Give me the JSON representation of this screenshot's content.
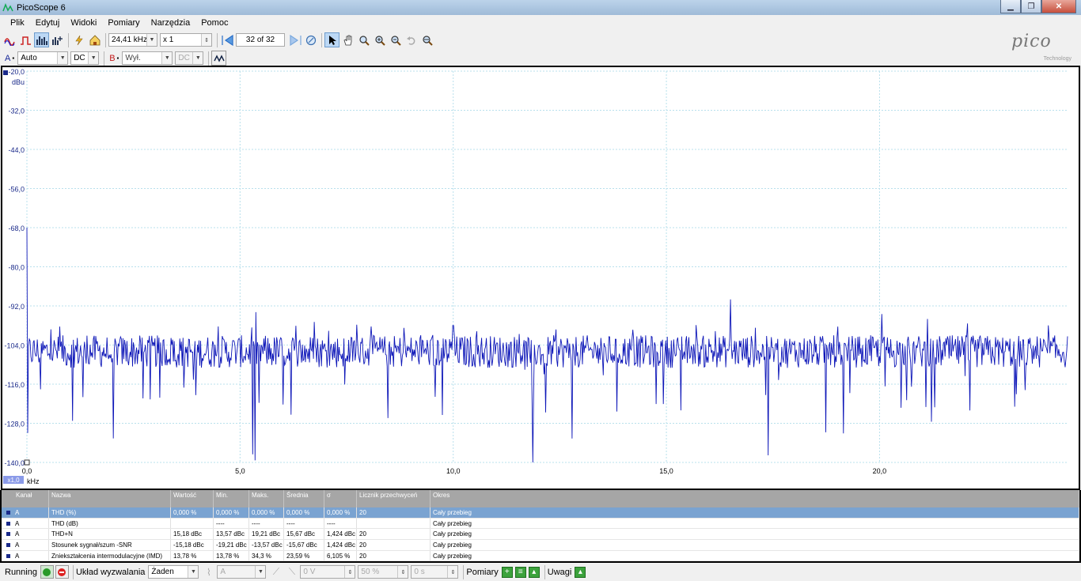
{
  "window": {
    "title": "PicoScope 6",
    "minimize": "▁",
    "maximize": "❐",
    "close": "✕"
  },
  "menu": [
    "Plik",
    "Edytuj",
    "Widoki",
    "Pomiary",
    "Narzędzia",
    "Pomoc"
  ],
  "toolbar": {
    "freq": "24,41 kHz",
    "mult": "x 1",
    "buffer": "32 of 32"
  },
  "channels": {
    "a_label": "A",
    "a_range": "Auto",
    "a_coupling": "DC",
    "b_label": "B",
    "b_range": "Wył.",
    "b_coupling": "DC"
  },
  "logo": {
    "text": "pico",
    "sub": "Technology"
  },
  "chart_data": {
    "type": "line",
    "y_unit": "dBu",
    "x_unit": "kHz",
    "x_scale_badge": "x1,0",
    "ylim": [
      -140,
      -20
    ],
    "xlim": [
      0,
      24.41
    ],
    "y_ticks": [
      "-20,0",
      "-32,0",
      "-44,0",
      "-56,0",
      "-68,0",
      "-80,0",
      "-92,0",
      "-104,0",
      "-116,0",
      "-128,0",
      "-140,0"
    ],
    "x_ticks": [
      "0,0",
      "5,0",
      "10,0",
      "15,0",
      "20,0"
    ],
    "series": [
      {
        "color": "#0d16b8",
        "noise_floor": -106,
        "peaks": [
          [
            0.0,
            -68
          ],
          [
            16.5,
            -90
          ],
          [
            10.0,
            -98
          ]
        ]
      }
    ]
  },
  "table": {
    "headers": [
      "Kanał",
      "Nazwa",
      "Wartość",
      "Min.",
      "Maks.",
      "Średnia",
      "σ",
      "Licznik przechwyceń",
      "Okres"
    ],
    "rows": [
      [
        "A",
        "THD (%)",
        "0,000 %",
        "0,000 %",
        "0,000 %",
        "0,000 %",
        "0,000 %",
        "20",
        "Cały przebieg"
      ],
      [
        "A",
        "THD (dB)",
        "",
        "----",
        "----",
        "----",
        "----",
        "",
        "Cały przebieg"
      ],
      [
        "A",
        "THD+N",
        "15,18 dBc",
        "13,57 dBc",
        "19,21 dBc",
        "15,67 dBc",
        "1,424 dBc",
        "20",
        "Cały przebieg"
      ],
      [
        "A",
        "Stosunek sygnał/szum -SNR",
        "-15,18 dBc",
        "-19,21 dBc",
        "-13,57 dBc",
        "-15,67 dBc",
        "1,424 dBc",
        "20",
        "Cały przebieg"
      ],
      [
        "A",
        "Zniekształcenia intermodulacyjne (IMD)",
        "13,78 %",
        "13,78 %",
        "34,3 %",
        "23,59 %",
        "6,105 %",
        "20",
        "Cały przebieg"
      ]
    ]
  },
  "status": {
    "running": "Running",
    "trigger_label": "Układ wyzwalania",
    "trigger_value": "Żaden",
    "trig_ch": "A",
    "trig_volt": "0 V",
    "trig_pct": "50 %",
    "trig_time": "0 s",
    "measurements": "Pomiary",
    "notes": "Uwagi"
  }
}
